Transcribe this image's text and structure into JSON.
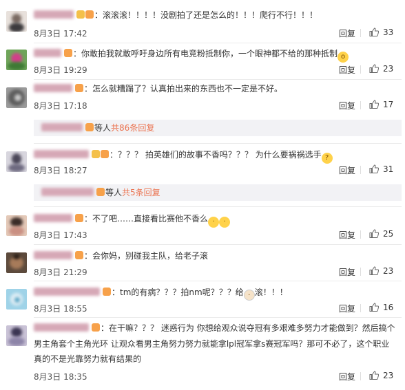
{
  "ui": {
    "reply_label": "回复",
    "sub_reply_suffix": "等人",
    "sub_reply_more_prefix": "共",
    "sub_reply_more_suffix": "条回复",
    "colon": "："
  },
  "comments": [
    {
      "text": "滚滚滚！！！！没剧拍了还是怎么的！！！爬行不行！！！",
      "date": "8月3日",
      "time": "17:42",
      "likes": "33"
    },
    {
      "text": "你敢拍我就敢呼吁身边所有电竞粉抵制你，一个眼神都不给的那种抵制",
      "date": "8月3日",
      "time": "19:29",
      "likes": "23"
    },
    {
      "text": "怎么就糟蹋了？认真拍出来的东西也不一定是不好。",
      "date": "8月3日",
      "time": "17:18",
      "likes": "17",
      "sub": {
        "count": "86"
      }
    },
    {
      "text": "？？？ 拍英雄们的故事不香吗？？？ 为什么要祸祸选手",
      "date": "8月3日",
      "time": "18:27",
      "likes": "31",
      "sub": {
        "count": "5"
      }
    },
    {
      "text": "不了吧……直接看比赛他不香么",
      "date": "8月3日",
      "time": "17:43",
      "likes": "25"
    },
    {
      "text": "会你妈，别碰我主队，给老子滚",
      "date": "8月3日",
      "time": "21:29",
      "likes": "23"
    },
    {
      "text_a": "tm的有病？？？拍nm呢？？？给",
      "text_b": "滚！！！",
      "date": "8月3日",
      "time": "18:55",
      "likes": "16"
    },
    {
      "line1": "在干嘛？？？ 迷惑行为 你想给观众说夺冠有多艰难多努力才能做到？然后搞个",
      "line2": "男主角套个主角光环 让观众看男主角努力努力就能拿lpl冠军拿s赛冠军吗？那可不必了，这个职业",
      "line3": "真的不是光靠努力就有结果的",
      "date": "8月3日",
      "time": "18:35",
      "likes": "23"
    }
  ]
}
